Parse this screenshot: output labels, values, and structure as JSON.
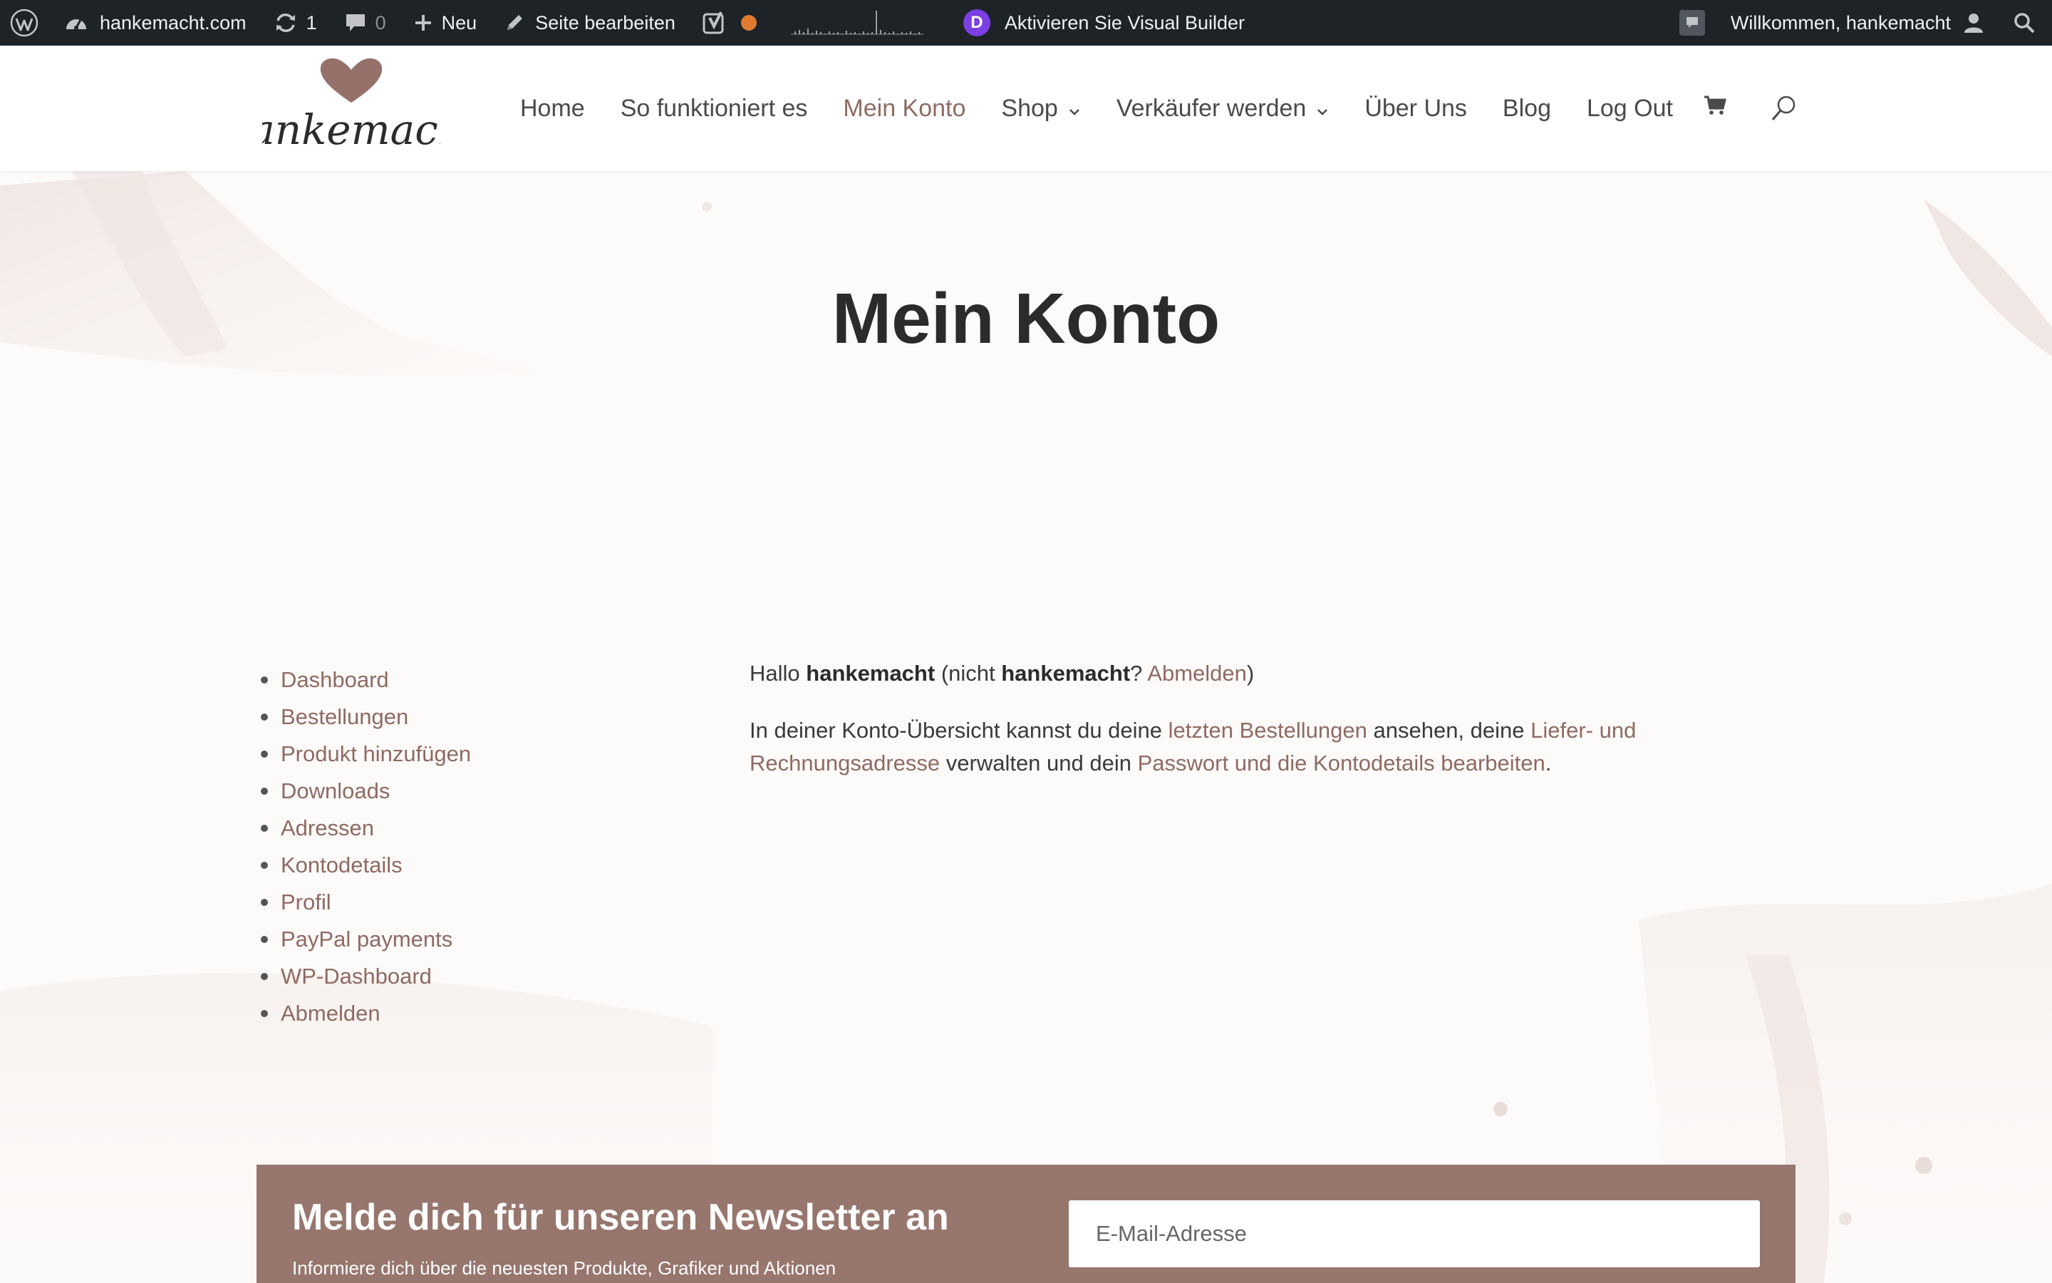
{
  "adminbar": {
    "site_name": "hankemacht.com",
    "updates_count": "1",
    "comments_count": "0",
    "new_label": "Neu",
    "edit_page_label": "Seite bearbeiten",
    "visual_builder_icon_letter": "D",
    "visual_builder_label": "Aktivieren Sie Visual Builder",
    "welcome_label": "Willkommen, hankemacht"
  },
  "header": {
    "logo_text": "Hankemacht",
    "nav": [
      {
        "label": "Home"
      },
      {
        "label": "So funktioniert es"
      },
      {
        "label": "Mein Konto",
        "active": true
      },
      {
        "label": "Shop",
        "dropdown": true
      },
      {
        "label": "Verkäufer werden",
        "dropdown": true
      },
      {
        "label": "Über Uns"
      },
      {
        "label": "Blog"
      },
      {
        "label": "Log Out"
      }
    ]
  },
  "page": {
    "title": "Mein Konto"
  },
  "account_nav": [
    "Dashboard",
    "Bestellungen",
    "Produkt hinzufügen",
    "Downloads",
    "Adressen",
    "Kontodetails",
    "Profil",
    "PayPal payments",
    "WP-Dashboard",
    "Abmelden"
  ],
  "content": {
    "greeting_prefix": "Hallo",
    "username": "hankemacht",
    "greeting_mid": "(nicht",
    "username2": "hankemacht",
    "greeting_q": "?",
    "logout_link": "Abmelden",
    "greeting_end": ")",
    "overview_1": "In deiner Konto-Übersicht kannst du deine",
    "orders_link": "letzten Bestellungen",
    "overview_2": "ansehen, deine",
    "address_link": "Liefer- und Rechnungsadresse",
    "overview_3": "verwalten und dein",
    "account_link": "Passwort und die Kontodetails bearbeiten",
    "overview_4": "."
  },
  "newsletter": {
    "title": "Melde dich für unseren Newsletter an",
    "subtitle": "Informiere dich über die neuesten Produkte, Grafiker und Aktionen",
    "email_placeholder": "E-Mail-Adresse"
  },
  "colors": {
    "accent": "#8f6a62",
    "adminbar_bg": "#1d2327",
    "newsletter_bg": "#97766d",
    "divi_purple": "#7b3fe4",
    "status_dot": "#e07a2e"
  }
}
